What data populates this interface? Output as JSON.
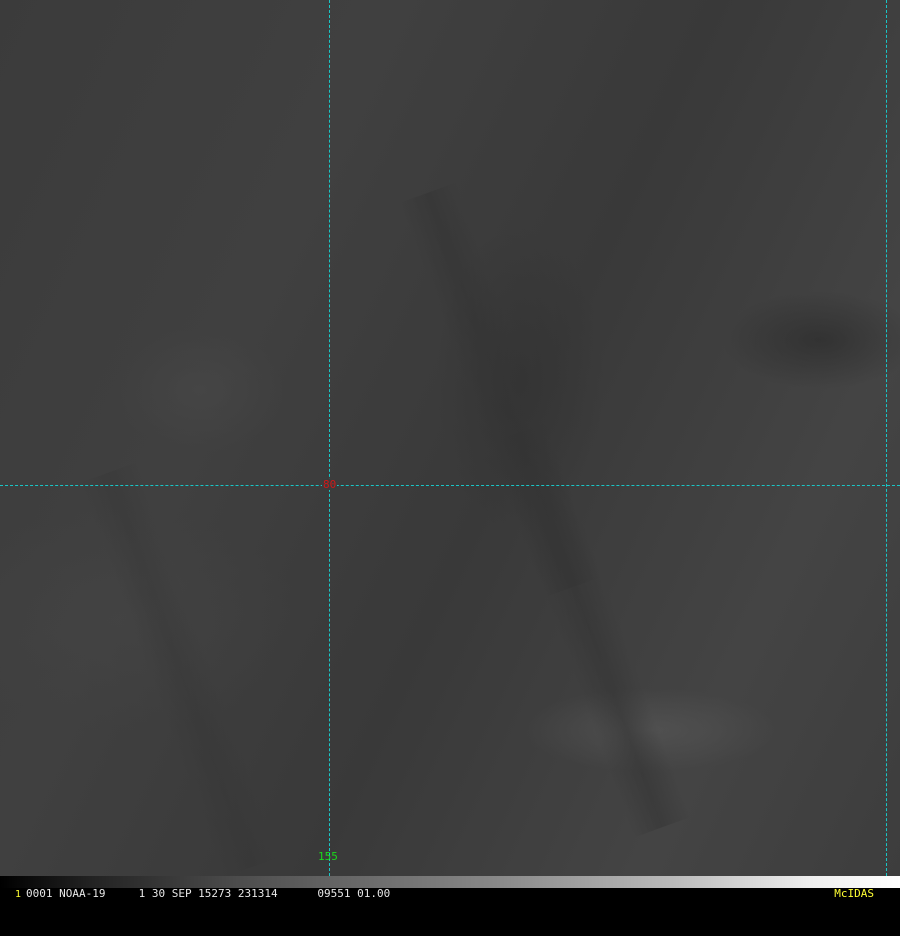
{
  "image": {
    "frame_number": "1",
    "info_text": "0001 NOAA-19     1 30 SEP 15273 231314      09551 01.00",
    "logo": "McIDAS"
  },
  "grid": {
    "latitude_label": "80",
    "longitude_label": "155",
    "line_color": "#19c6c6"
  }
}
